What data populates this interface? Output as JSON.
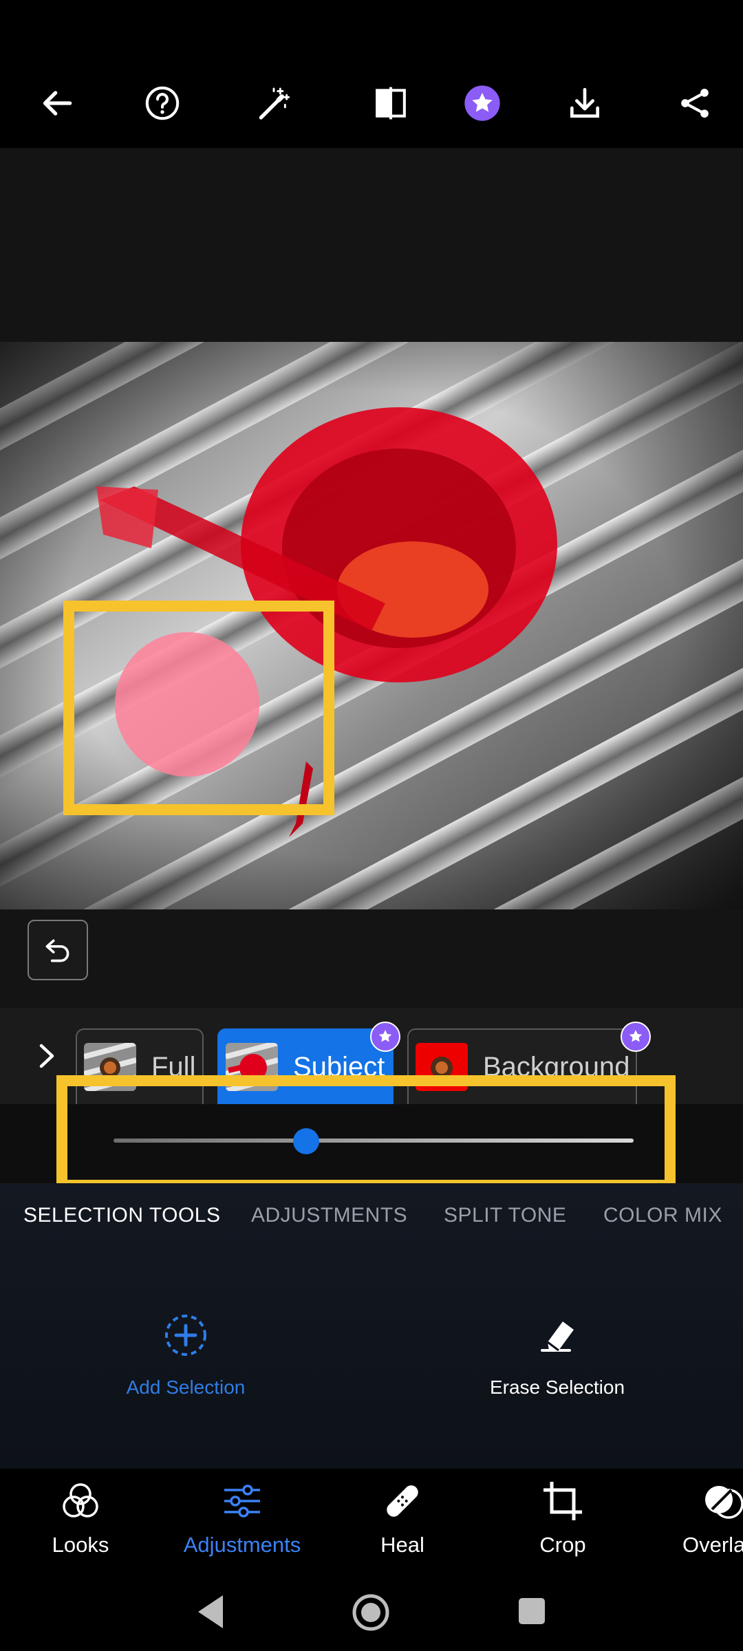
{
  "toolbar": {
    "icons": [
      "back-arrow-icon",
      "help-icon",
      "magic-wand-icon",
      "compare-icon",
      "premium-star-icon",
      "download-icon",
      "share-icon"
    ],
    "premium_color": "#8b5cf6"
  },
  "masks": {
    "items": [
      {
        "label": "Full",
        "active": false,
        "premium": false
      },
      {
        "label": "Subject",
        "active": true,
        "premium": true
      },
      {
        "label": "Background",
        "active": false,
        "premium": true
      }
    ]
  },
  "slider": {
    "value": 0.37
  },
  "panel_tabs": [
    {
      "label": "SELECTION TOOLS",
      "active": true
    },
    {
      "label": "ADJUSTMENTS",
      "active": false
    },
    {
      "label": "SPLIT TONE",
      "active": false
    },
    {
      "label": "COLOR MIX",
      "active": false
    }
  ],
  "tools": {
    "add": {
      "label": "Add Selection",
      "icon": "add-selection-icon"
    },
    "erase": {
      "label": "Erase Selection",
      "icon": "eraser-icon"
    }
  },
  "bottom_nav": [
    {
      "label": "Looks",
      "icon": "looks-icon",
      "active": false
    },
    {
      "label": "Adjustments",
      "icon": "adjustments-icon",
      "active": true
    },
    {
      "label": "Heal",
      "icon": "bandage-icon",
      "active": false
    },
    {
      "label": "Crop",
      "icon": "crop-icon",
      "active": false
    },
    {
      "label": "Overla",
      "icon": "overlays-icon",
      "active": false
    }
  ],
  "colors": {
    "accent": "#1473e6",
    "highlight": "#f6c32c",
    "mask_overlay": "#e0001b"
  }
}
